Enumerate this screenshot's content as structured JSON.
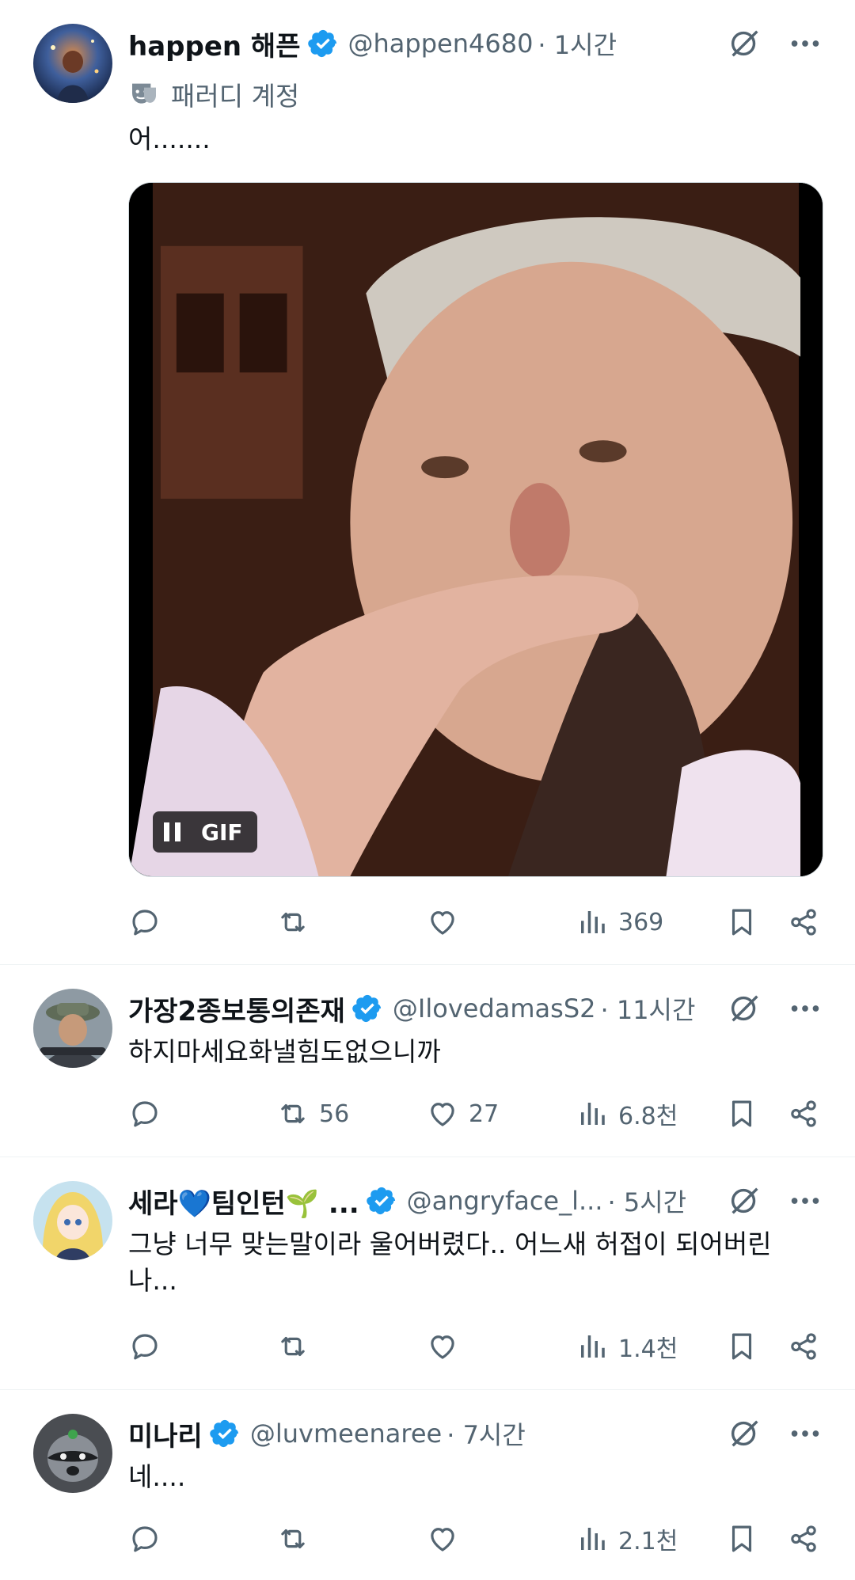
{
  "tweets": [
    {
      "name": "happen 해픈",
      "handle": "@happen4680",
      "time": "· 1시간",
      "parody_label": "패러디 계정",
      "text": "어.......",
      "media": {
        "type": "GIF",
        "badge": "GIF"
      },
      "stats": {
        "replies": "",
        "retweets": "",
        "likes": "",
        "views": "369"
      }
    },
    {
      "name": "가장2종보통의존재",
      "handle": "@IlovedamasS2",
      "time": "· 11시간",
      "text": "하지마세요화낼힘도없으니까",
      "stats": {
        "replies": "",
        "retweets": "56",
        "likes": "27",
        "views": "6.8천"
      }
    },
    {
      "name": "세라💙팀인턴🌱 ...",
      "handle": "@angryface_l...",
      "time": "· 5시간",
      "text_line1": "그냥 너무 맞는말이라 울어버렸다.. 어느새 허접이 되어버린",
      "text_line2": "나...",
      "stats": {
        "replies": "",
        "retweets": "",
        "likes": "",
        "views": "1.4천"
      }
    },
    {
      "name": "미나리",
      "handle": "@luvmeenaree",
      "time": "· 7시간",
      "text": "네....",
      "stats": {
        "replies": "",
        "retweets": "",
        "likes": "",
        "views": "2.1천"
      }
    }
  ],
  "icons": {
    "verified": "verified-badge-icon",
    "grok": "grok-icon",
    "more": "more-icon",
    "reply": "reply-icon",
    "retweet": "retweet-icon",
    "like": "like-icon",
    "views": "views-icon",
    "bookmark": "bookmark-icon",
    "share": "share-icon",
    "parody": "parody-mask-icon"
  },
  "colors": {
    "verified": "#1d9bf0",
    "secondary_text": "#536471",
    "divider": "#eff3f4"
  }
}
